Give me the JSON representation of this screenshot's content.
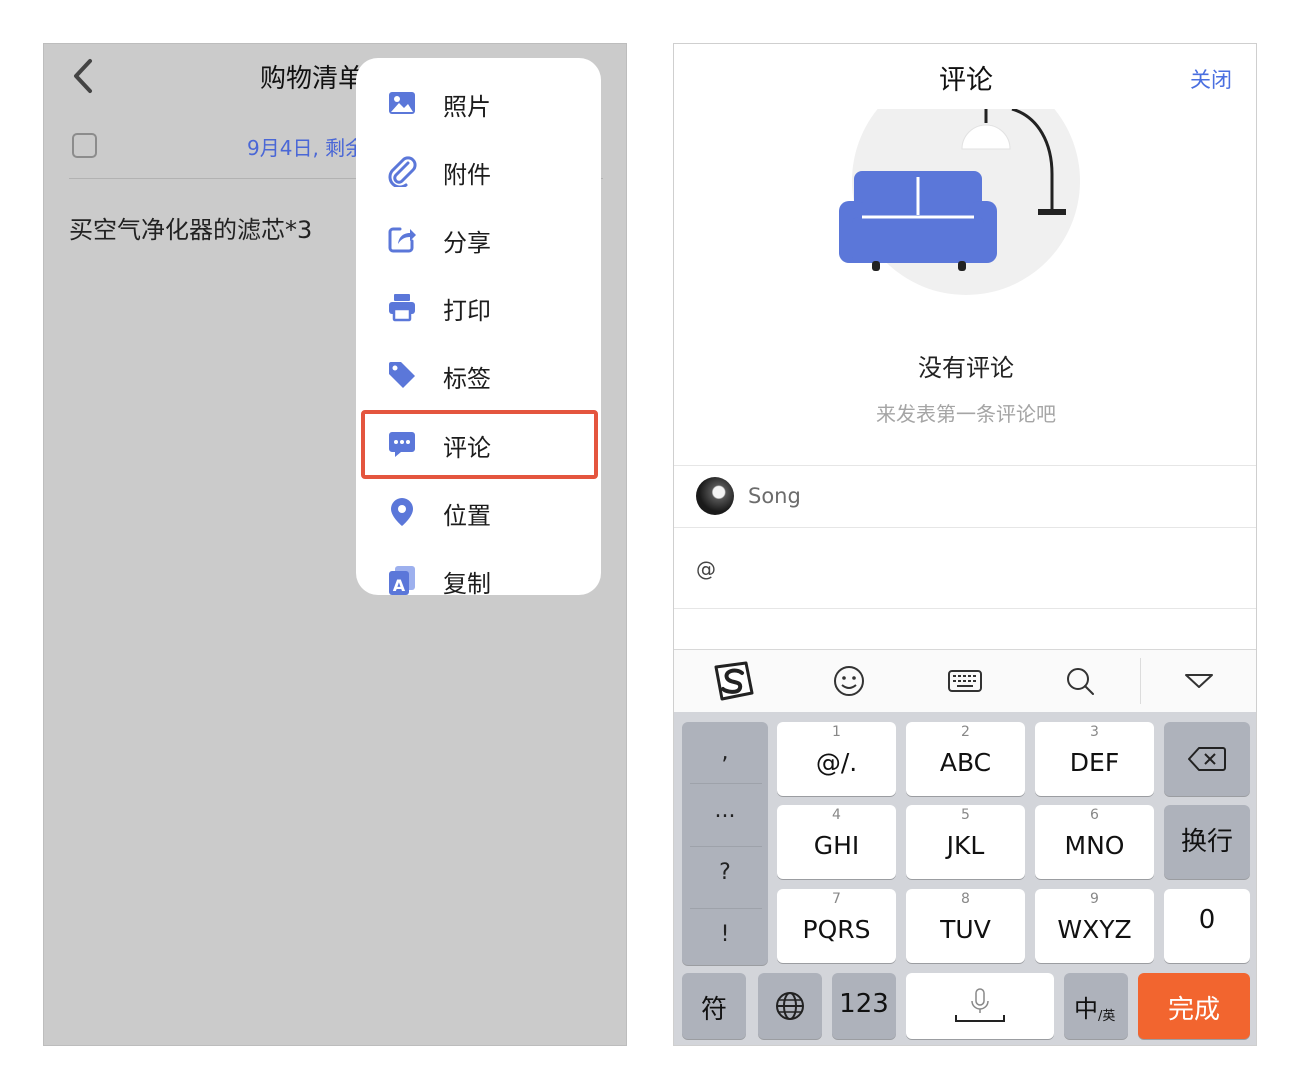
{
  "left": {
    "title": "购物清单",
    "date_text": "9月4日, 剩余",
    "note_text": "买空气净化器的滤芯*3",
    "menu": [
      {
        "label": "照片",
        "icon": "photo-icon"
      },
      {
        "label": "附件",
        "icon": "paperclip-icon"
      },
      {
        "label": "分享",
        "icon": "share-icon"
      },
      {
        "label": "打印",
        "icon": "printer-icon"
      },
      {
        "label": "标签",
        "icon": "tag-icon"
      },
      {
        "label": "评论",
        "icon": "comment-icon"
      },
      {
        "label": "位置",
        "icon": "location-pin-icon"
      },
      {
        "label": "复制",
        "icon": "copy-icon"
      }
    ],
    "highlighted_item": "评论"
  },
  "right": {
    "title": "评论",
    "close_label": "关闭",
    "empty_title": "没有评论",
    "empty_subtitle": "来发表第一条评论吧",
    "user_name": "Song",
    "input_value": "@",
    "keyboard": {
      "punctuation": [
        ",",
        "...",
        "?",
        "!"
      ],
      "keys": [
        {
          "num": "1",
          "label": "@/."
        },
        {
          "num": "2",
          "label": "ABC"
        },
        {
          "num": "3",
          "label": "DEF"
        },
        {
          "num": "4",
          "label": "GHI"
        },
        {
          "num": "5",
          "label": "JKL"
        },
        {
          "num": "6",
          "label": "MNO"
        },
        {
          "num": "7",
          "label": "PQRS"
        },
        {
          "num": "8",
          "label": "TUV"
        },
        {
          "num": "9",
          "label": "WXYZ"
        }
      ],
      "newline_label": "换行",
      "zero_label": "0",
      "symbol_label": "符",
      "num_label": "123",
      "lang_label_main": "中",
      "lang_label_sub": "/英",
      "done_label": "完成"
    }
  },
  "colors": {
    "accent": "#5b77d9",
    "highlight": "#e4553e",
    "done": "#f2652f"
  }
}
